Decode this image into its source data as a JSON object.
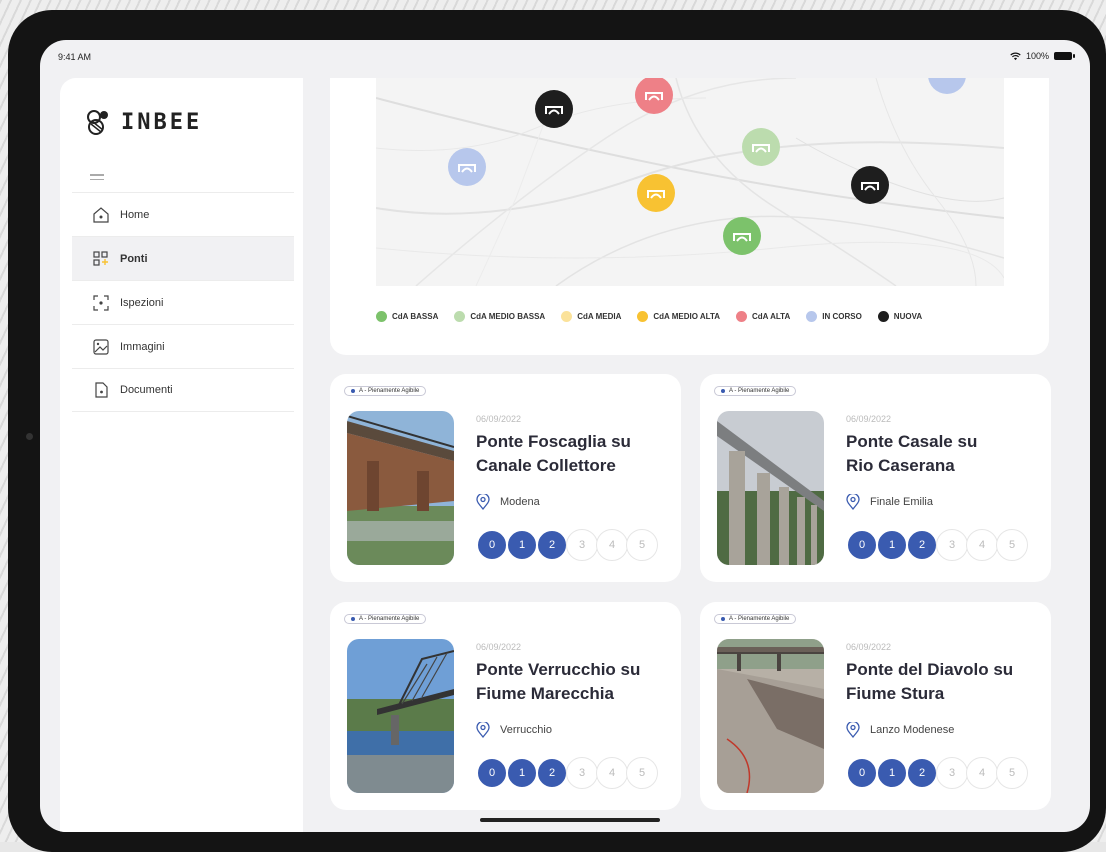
{
  "status": {
    "time": "9:41 AM",
    "battery": "100%"
  },
  "brand": {
    "name": "INBEE"
  },
  "sidebar": {
    "items": [
      {
        "label": "Home",
        "icon": "home-icon"
      },
      {
        "label": "Ponti",
        "icon": "bridge-grid-icon",
        "active": true
      },
      {
        "label": "Ispezioni",
        "icon": "inspection-icon"
      },
      {
        "label": "Immagini",
        "icon": "image-icon"
      },
      {
        "label": "Documenti",
        "icon": "document-icon"
      }
    ]
  },
  "map": {
    "legend": [
      {
        "label": "CdA BASSA",
        "color": "#7cc26b"
      },
      {
        "label": "CdA MEDIO BASSA",
        "color": "#bcdcae"
      },
      {
        "label": "CdA MEDIA",
        "color": "#fbe29a"
      },
      {
        "label": "CdA MEDIO ALTA",
        "color": "#f8c232"
      },
      {
        "label": "CdA ALTA",
        "color": "#ee8087"
      },
      {
        "label": "IN CORSO",
        "color": "#b7c7ec"
      },
      {
        "label": "NUOVA",
        "color": "#1e1e1e"
      }
    ]
  },
  "bridges": [
    {
      "badge": "A - Pienamente Agibile",
      "date": "06/09/2022",
      "title_line1": "Ponte Foscaglia su",
      "title_line2": "Canale Collettore",
      "location": "Modena",
      "steps": [
        "0",
        "1",
        "2",
        "3",
        "4",
        "5"
      ],
      "completed": 3
    },
    {
      "badge": "A - Pienamente Agibile",
      "date": "06/09/2022",
      "title_line1": "Ponte Casale su",
      "title_line2": "Rio Caserana",
      "location": "Finale Emilia",
      "steps": [
        "0",
        "1",
        "2",
        "3",
        "4",
        "5"
      ],
      "completed": 3
    },
    {
      "badge": "A - Pienamente Agibile",
      "date": "06/09/2022",
      "title_line1": "Ponte Verrucchio su",
      "title_line2": "Fiume Marecchia",
      "location": "Verrucchio",
      "steps": [
        "0",
        "1",
        "2",
        "3",
        "4",
        "5"
      ],
      "completed": 3
    },
    {
      "badge": "A - Pienamente Agibile",
      "date": "06/09/2022",
      "title_line1": "Ponte del Diavolo su",
      "title_line2": "Fiume Stura",
      "location": "Lanzo Modenese",
      "steps": [
        "0",
        "1",
        "2",
        "3",
        "4",
        "5"
      ],
      "completed": 3
    }
  ]
}
